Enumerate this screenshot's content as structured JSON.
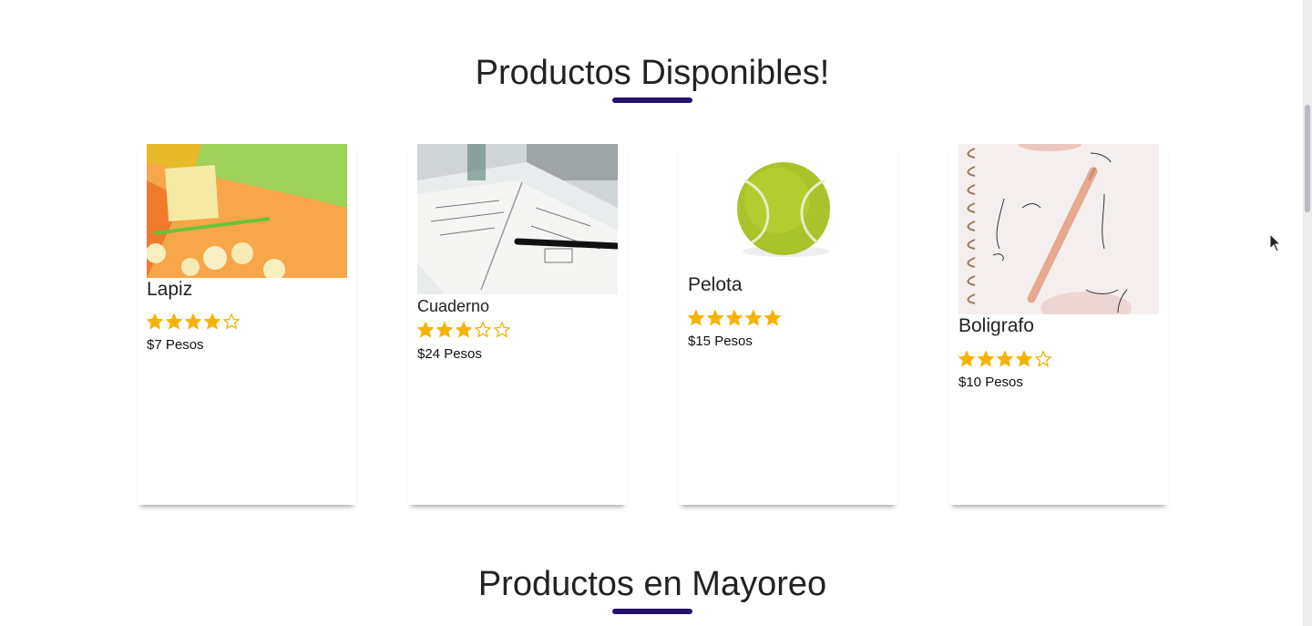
{
  "sections": {
    "available_title": "Productos Disponibles!",
    "wholesale_title": "Productos en Mayoreo"
  },
  "products": [
    {
      "name": "Lapiz",
      "rating": 4,
      "max_rating": 5,
      "price": "$7 Pesos"
    },
    {
      "name": "Cuaderno",
      "rating": 3,
      "max_rating": 5,
      "price": "$24 Pesos"
    },
    {
      "name": "Pelota",
      "rating": 5,
      "max_rating": 5,
      "price": "$15 Pesos"
    },
    {
      "name": "Boligrafo",
      "rating": 4,
      "max_rating": 5,
      "price": "$10 Pesos"
    }
  ],
  "colors": {
    "accent_underline": "#25106b",
    "star": "#f5b301"
  }
}
